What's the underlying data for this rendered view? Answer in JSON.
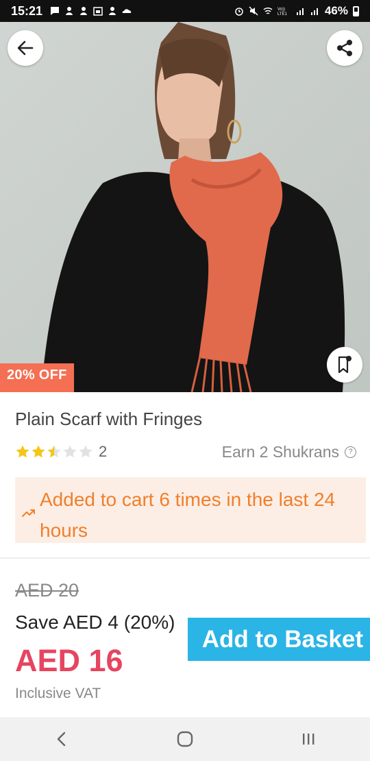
{
  "status_bar": {
    "time": "15:21",
    "battery": "46%",
    "left_icons": [
      "message-icon",
      "app-icon",
      "app-icon",
      "calendar-icon",
      "app-icon",
      "cloud-icon"
    ],
    "right_icons": [
      "alarm-icon",
      "mute-icon",
      "wifi-icon",
      "volte-icon",
      "signal-icon",
      "signal-icon",
      "battery-icon"
    ]
  },
  "hero": {
    "discount_label": "20% OFF",
    "back_icon": "arrow-left-icon",
    "share_icon": "share-icon",
    "wishlist_icon": "bookmark-icon"
  },
  "product": {
    "title": "Plain Scarf with Fringes",
    "rating": 2.5,
    "rating_max": 5,
    "review_count": "2",
    "shukrans_text": "Earn 2 Shukrans",
    "trend_text": "Added to cart 6 times in the last 24 hours",
    "old_price": "AED 20",
    "save_text": "Save AED 4 (20%)",
    "price": "AED 16",
    "vat_text": "Inclusive VAT",
    "add_button": "Add to Basket"
  },
  "nav_bar": {
    "back_icon": "nav-back-icon",
    "home_icon": "nav-home-icon",
    "recents_icon": "nav-recents-icon"
  },
  "colors": {
    "accent": "#2bb4e6",
    "price": "#e64561",
    "discount_tag": "#f46f53",
    "trend_text": "#f07f2a",
    "trend_bg": "#fdeee5",
    "star": "#f5c518",
    "status_bar": "#111111"
  }
}
